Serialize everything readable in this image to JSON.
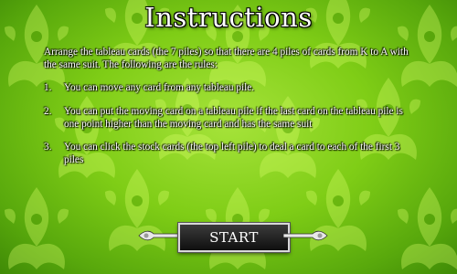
{
  "title": "Instructions",
  "intro": "Arrange the tableau cards (the 7 piles) so that there are 4 piles of cards from K to A with the same suit. The following are the rules:",
  "rules": [
    {
      "num": "1.",
      "text": "You can move any card from any tableau pile."
    },
    {
      "num": "2.",
      "text": "You can put the moving card on a tableau pile if the last card on the tableau pile is one point higher than the moving card and has the same suit"
    },
    {
      "num": "3.",
      "text": "You can click the stock cards (the top left pile) to deal a card to each of the first 3 piles"
    }
  ],
  "start_label": "START",
  "colors": {
    "background": "#7fcd16",
    "text": "#ffffff",
    "button": "#1f1f1f"
  }
}
